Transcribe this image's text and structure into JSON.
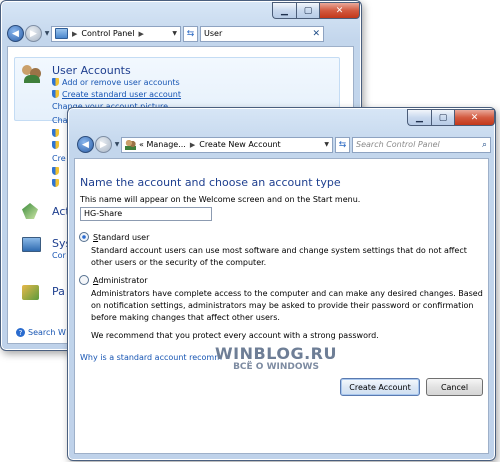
{
  "back_window": {
    "address_root": "Control Panel",
    "search_value": "User",
    "user_accounts": {
      "heading": "User Accounts",
      "tasks": [
        "Add or remove user accounts",
        "Create standard user account",
        "Change your account picture"
      ],
      "partials": [
        "Cha",
        "Cre"
      ]
    },
    "other_sections": [
      {
        "text": "Act",
        "sub": ""
      },
      {
        "text": "Sys",
        "sub": "Cor"
      },
      {
        "text": "Pa",
        "sub": ""
      }
    ],
    "search_windows": "Search W"
  },
  "front_window": {
    "breadcrumb": [
      "« Manage...",
      "Create New Account"
    ],
    "search_placeholder": "Search Control Panel",
    "heading": "Name the account and choose an account type",
    "name_prompt": "This name will appear on the Welcome screen and on the Start menu.",
    "name_value": "HG-Share",
    "options": [
      {
        "label": "Standard user",
        "underline_char": "S",
        "rest": "tandard user",
        "selected": true,
        "description": "Standard account users can use most software and change system settings that do not affect other users or the security of the computer."
      },
      {
        "label": "Administrator",
        "underline_char": "A",
        "rest": "dministrator",
        "selected": false,
        "description": "Administrators have complete access to the computer and can make any desired changes. Based on notification settings, administrators may be asked to provide their password or confirmation before making changes that affect other users."
      }
    ],
    "recommendation": "We recommend that you protect every account with a strong password.",
    "help_link": "Why is a standard account recomm",
    "buttons": {
      "create": "Create Account",
      "cancel": "Cancel"
    }
  },
  "watermark": {
    "line1": "WINBLOG.RU",
    "line2": "ВСЁ О WINDOWS"
  },
  "colors": {
    "heading": "#1e3f8f",
    "link": "#1755b3",
    "watermark": "#6e7e96"
  }
}
